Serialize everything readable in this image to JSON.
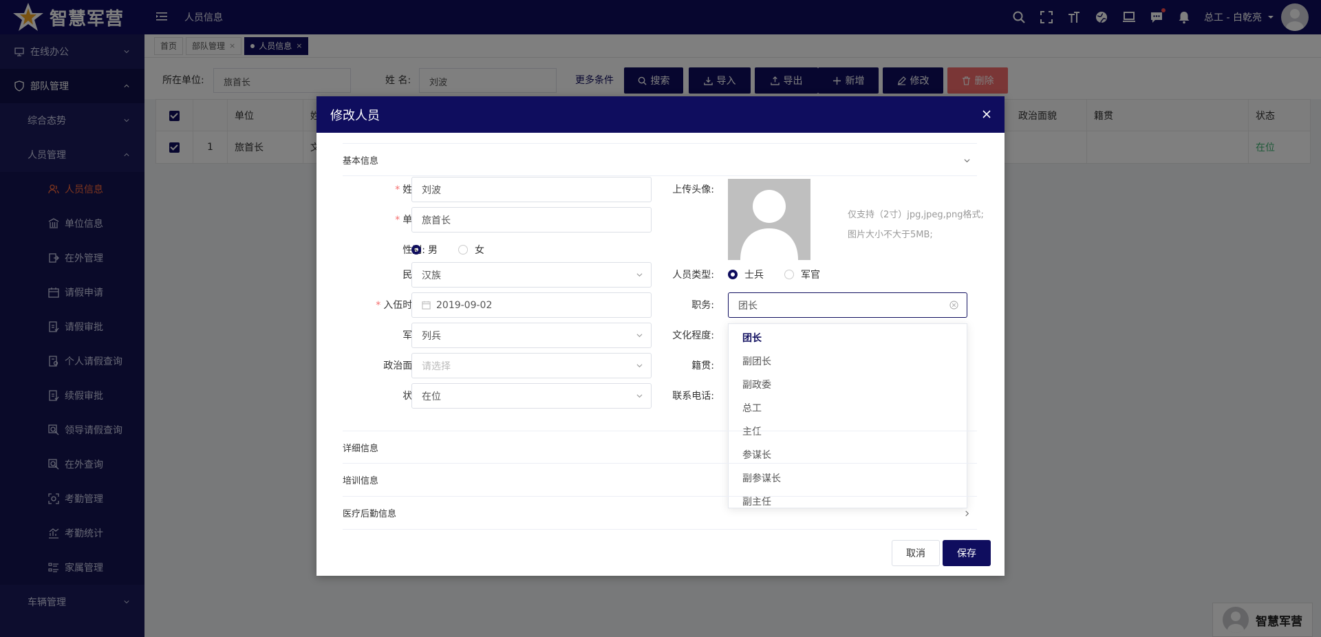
{
  "app": {
    "title": "智慧军营",
    "breadcrumb": "人员信息"
  },
  "header": {
    "user": "总工 - 白乾亮"
  },
  "sidebar": {
    "items": [
      {
        "label": "在线办公",
        "level": "main",
        "icon": "desktop-icon"
      },
      {
        "label": "部队管理",
        "level": "main",
        "icon": "shield-icon",
        "active": true
      },
      {
        "label": "综合态势",
        "level": "sub"
      },
      {
        "label": "人员管理",
        "level": "sub"
      },
      {
        "label": "人员信息",
        "level": "leaf",
        "icon": "people-icon",
        "active": true
      },
      {
        "label": "单位信息",
        "level": "leaf",
        "icon": "bank-icon"
      },
      {
        "label": "在外管理",
        "level": "leaf",
        "icon": "out-icon"
      },
      {
        "label": "请假申请",
        "level": "leaf",
        "icon": "calendar-icon"
      },
      {
        "label": "请假审批",
        "level": "leaf",
        "icon": "approve-icon"
      },
      {
        "label": "个人请假查询",
        "level": "leaf",
        "icon": "doc-search-icon"
      },
      {
        "label": "续假审批",
        "level": "leaf",
        "icon": "approve-icon"
      },
      {
        "label": "领导请假查询",
        "level": "leaf",
        "icon": "search-icon"
      },
      {
        "label": "在外查询",
        "level": "leaf",
        "icon": "search-icon"
      },
      {
        "label": "考勤管理",
        "level": "leaf",
        "icon": "scan-icon"
      },
      {
        "label": "考勤统计",
        "level": "leaf",
        "icon": "chart-icon"
      },
      {
        "label": "家属管理",
        "level": "leaf",
        "icon": "list-icon"
      },
      {
        "label": "车辆管理",
        "level": "sub"
      }
    ]
  },
  "tabs": [
    {
      "label": "首页",
      "closable": false
    },
    {
      "label": "部队管理",
      "closable": true
    },
    {
      "label": "人员信息",
      "closable": true,
      "active": true
    }
  ],
  "search": {
    "unit_label": "所在单位:",
    "unit_value": "旅首长",
    "name_label": "姓 名:",
    "name_value": "刘波",
    "more": "更多条件",
    "buttons": {
      "search": "搜索",
      "import": "导入",
      "export": "导出",
      "add": "新增",
      "edit": "修改",
      "delete": "删除"
    }
  },
  "table": {
    "headers": {
      "unit": "单位",
      "name_partial": "姓",
      "political": "政治面貌",
      "native": "籍贯",
      "status": "状态"
    },
    "rows": [
      {
        "index": "1",
        "unit": "旅首长",
        "name_partial": "文",
        "status": "在位"
      }
    ]
  },
  "modal": {
    "title": "修改人员",
    "sections": {
      "basic": "基本信息",
      "detail": "详细信息",
      "training": "培训信息",
      "medical": "医疗后勤信息"
    },
    "fields": {
      "name_label": "姓名:",
      "name_value": "刘波",
      "unit_label": "单位:",
      "unit_value": "旅首长",
      "gender_label": "性别:",
      "gender_male": "男",
      "gender_female": "女",
      "ethnic_label": "民族:",
      "ethnic_value": "汉族",
      "enlist_label": "入伍时间:",
      "enlist_value": "2019-09-02",
      "rank_label": "军衔:",
      "rank_value": "列兵",
      "political_label": "政治面貌:",
      "political_placeholder": "请选择",
      "status_label": "状态:",
      "status_value": "在位",
      "avatar_label": "上传头像:",
      "avatar_hint1": "仅支持（2寸）jpg,jpeg,png格式;",
      "avatar_hint2": "图片大小不大于5MB;",
      "type_label": "人员类型:",
      "type_soldier": "士兵",
      "type_officer": "军官",
      "duty_label": "职务:",
      "duty_value": "团长",
      "edu_label": "文化程度:",
      "native_label": "籍贯:",
      "phone_label": "联系电话:"
    },
    "duty_options": [
      "团长",
      "副团长",
      "副政委",
      "总工",
      "主任",
      "参谋长",
      "副参谋长",
      "副主任"
    ],
    "cancel": "取消",
    "save": "保存"
  },
  "footer": {
    "brand": "智慧军营"
  }
}
